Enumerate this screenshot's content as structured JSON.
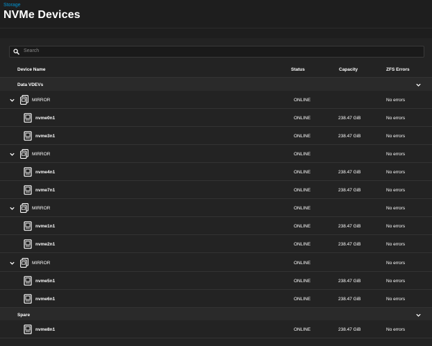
{
  "header": {
    "breadcrumb": "Storage",
    "title": "NVMe Devices"
  },
  "search": {
    "placeholder": "Search"
  },
  "columns": {
    "device_name": "Device Name",
    "status": "Status",
    "capacity": "Capacity",
    "zfs_errors": "ZFS Errors"
  },
  "groups": {
    "data_vdevs": "Data VDEVs",
    "spare": "Spare"
  },
  "rows": [
    {
      "type": "vdev",
      "name": "MIRROR",
      "status": "ONLINE",
      "capacity": "",
      "errors": "No errors"
    },
    {
      "type": "disk",
      "name": "nvme0n1",
      "status": "ONLINE",
      "capacity": "238.47 GiB",
      "errors": "No errors"
    },
    {
      "type": "disk",
      "name": "nvme3n1",
      "status": "ONLINE",
      "capacity": "238.47 GiB",
      "errors": "No errors"
    },
    {
      "type": "vdev",
      "name": "MIRROR",
      "status": "ONLINE",
      "capacity": "",
      "errors": "No errors"
    },
    {
      "type": "disk",
      "name": "nvme4n1",
      "status": "ONLINE",
      "capacity": "238.47 GiB",
      "errors": "No errors"
    },
    {
      "type": "disk",
      "name": "nvme7n1",
      "status": "ONLINE",
      "capacity": "238.47 GiB",
      "errors": "No errors"
    },
    {
      "type": "vdev",
      "name": "MIRROR",
      "status": "ONLINE",
      "capacity": "",
      "errors": "No errors"
    },
    {
      "type": "disk",
      "name": "nvme1n1",
      "status": "ONLINE",
      "capacity": "238.47 GiB",
      "errors": "No errors"
    },
    {
      "type": "disk",
      "name": "nvme2n1",
      "status": "ONLINE",
      "capacity": "238.47 GiB",
      "errors": "No errors"
    },
    {
      "type": "vdev",
      "name": "MIRROR",
      "status": "ONLINE",
      "capacity": "",
      "errors": "No errors"
    },
    {
      "type": "disk",
      "name": "nvme5n1",
      "status": "ONLINE",
      "capacity": "238.47 GiB",
      "errors": "No errors"
    },
    {
      "type": "disk",
      "name": "nvme6n1",
      "status": "ONLINE",
      "capacity": "238.47 GiB",
      "errors": "No errors"
    },
    {
      "type": "disk",
      "name": "nvme8n1",
      "status": "ONLINE",
      "capacity": "238.47 GiB",
      "errors": "No errors"
    }
  ],
  "colors": {
    "accent": "#0095d5",
    "background": "#1e1e1e",
    "panel": "#232323",
    "group_header": "#2a2a2a"
  },
  "icons": {
    "search": "search-icon",
    "chevron": "chevron-down-icon",
    "disk": "disk-icon",
    "vdev": "mirror-icon"
  }
}
